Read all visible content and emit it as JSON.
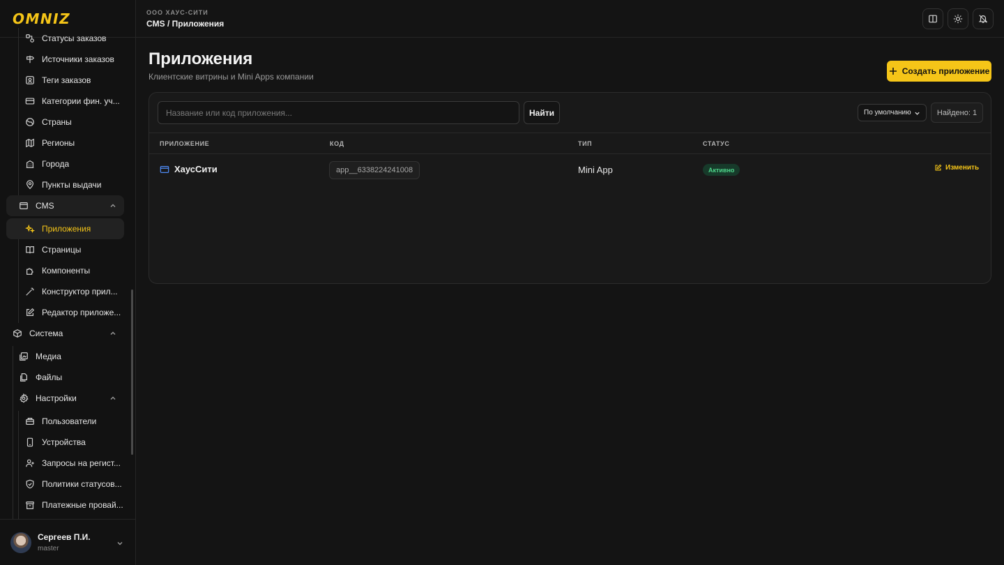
{
  "brand": {
    "logo": "OMNIZ",
    "accent": "#f5c518"
  },
  "topbar": {
    "company": "ООО ХАУС-СИТИ",
    "breadcrumb": "CMS / Приложения",
    "buttons": [
      "book-icon",
      "sun-icon",
      "bell-icon"
    ]
  },
  "sidebar": {
    "items_top": [
      {
        "label": "Статусы заказов",
        "icon": "status-icon"
      },
      {
        "label": "Источники заказов",
        "icon": "signpost-icon"
      },
      {
        "label": "Теги заказов",
        "icon": "tag-icon"
      },
      {
        "label": "Категории фин. уч...",
        "icon": "card-icon"
      },
      {
        "label": "Страны",
        "icon": "globe-icon"
      },
      {
        "label": "Регионы",
        "icon": "map-icon"
      },
      {
        "label": "Города",
        "icon": "building-icon"
      },
      {
        "label": "Пункты выдачи",
        "icon": "pin-icon"
      }
    ],
    "cms_group": "CMS",
    "cms_items": [
      {
        "label": "Приложения",
        "icon": "sparkles-icon",
        "active": true
      },
      {
        "label": "Страницы",
        "icon": "book-icon"
      },
      {
        "label": "Компоненты",
        "icon": "puzzle-icon"
      },
      {
        "label": "Конструктор прил...",
        "icon": "wand-icon"
      },
      {
        "label": "Редактор приложе...",
        "icon": "edit-icon"
      }
    ],
    "system_group": "Система",
    "system_items": [
      {
        "label": "Медиа",
        "icon": "media-icon"
      },
      {
        "label": "Файлы",
        "icon": "files-icon"
      }
    ],
    "settings_group": "Настройки",
    "settings_items": [
      {
        "label": "Пользователи",
        "icon": "users-icon"
      },
      {
        "label": "Устройства",
        "icon": "phone-icon"
      },
      {
        "label": "Запросы на регист...",
        "icon": "user-plus-icon"
      },
      {
        "label": "Политики статусов...",
        "icon": "shield-icon"
      },
      {
        "label": "Платежные провай...",
        "icon": "archive-icon"
      }
    ],
    "user": {
      "name": "Сергеев П.И.",
      "role": "master"
    }
  },
  "main": {
    "title": "Приложения",
    "subtitle": "Клиентские витрины и Mini Apps компании",
    "create_label": "Создать приложение",
    "search_placeholder": "Название или код приложения...",
    "search_value": "",
    "find_label": "Найти",
    "sort_value": "По умолчанию",
    "found_label": "Найдено: 1",
    "columns": [
      "ПРИЛОЖЕНИЕ",
      "КОД",
      "ТИП",
      "СТАТУС"
    ],
    "rows": [
      {
        "name": "ХаусСити",
        "code": "app__6338224241008",
        "type": "Mini App",
        "status": "Активно",
        "action": "Изменить"
      }
    ]
  }
}
